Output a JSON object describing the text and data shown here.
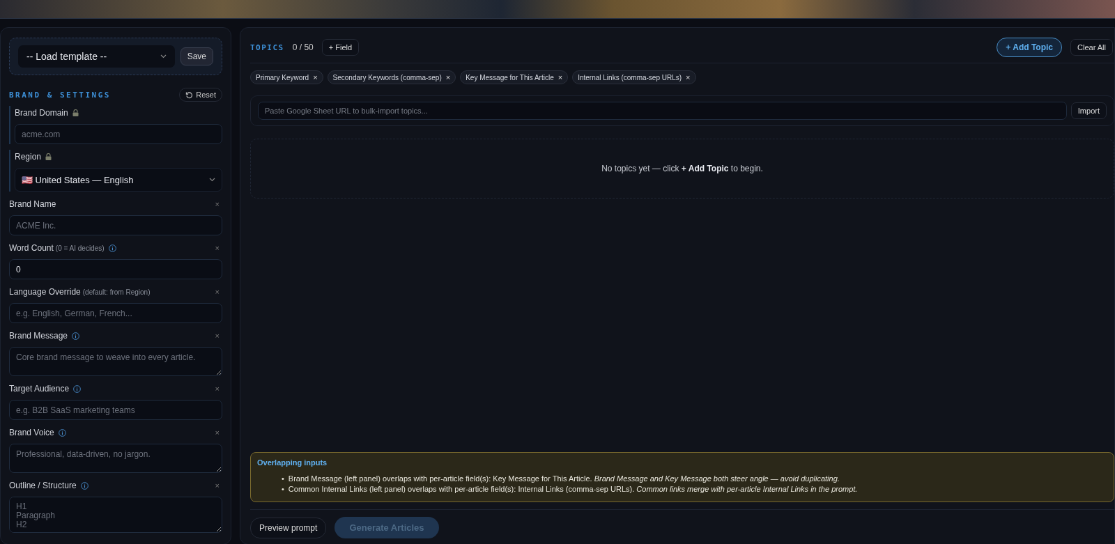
{
  "template": {
    "placeholder": "-- Load template --",
    "save": "Save"
  },
  "settings": {
    "title": "BRAND & SETTINGS",
    "reset": "Reset",
    "fields": [
      {
        "kind": "input",
        "label": "Brand Domain",
        "locked": true,
        "info": false,
        "placeholder": "acme.com"
      },
      {
        "kind": "select",
        "label": "Region",
        "locked": true,
        "info": false,
        "value": "🇺🇸 United States — English"
      },
      {
        "kind": "input",
        "label": "Brand Name",
        "locked": false,
        "info": false,
        "clear": "×",
        "placeholder": "ACME Inc."
      },
      {
        "kind": "input",
        "label": "Word Count",
        "hint": "(0 = AI decides)",
        "locked": false,
        "info": true,
        "clear": "×",
        "value": "0"
      },
      {
        "kind": "input",
        "label": "Language Override",
        "hint": "(default: from Region)",
        "locked": false,
        "info": false,
        "clear": "×",
        "placeholder": "e.g. English, German, French..."
      },
      {
        "kind": "textarea",
        "label": "Brand Message",
        "locked": false,
        "info": true,
        "clear": "×",
        "placeholder": "Core brand message to weave into every article."
      },
      {
        "kind": "input",
        "label": "Target Audience",
        "locked": false,
        "info": true,
        "clear": "×",
        "placeholder": "e.g. B2B SaaS marketing teams"
      },
      {
        "kind": "textarea",
        "label": "Brand Voice",
        "locked": false,
        "info": true,
        "clear": "×",
        "placeholder": "Professional, data-driven, no jargon."
      },
      {
        "kind": "textarea",
        "label": "Outline / Structure",
        "locked": false,
        "info": true,
        "clear": "×",
        "placeholder": "H1\nParagraph\nH2"
      }
    ]
  },
  "topics": {
    "title": "TOPICS",
    "count": "0 / 50",
    "add_field": "+ Field",
    "add_topic": "+ Add Topic",
    "clear_all": "Clear All",
    "fields": [
      {
        "label": "Primary Keyword",
        "remove": "×"
      },
      {
        "label": "Secondary Keywords (comma-sep)",
        "remove": "×"
      },
      {
        "label": "Key Message for This Article",
        "remove": "×"
      },
      {
        "label": "Internal Links (comma-sep URLs)",
        "remove": "×"
      }
    ],
    "import": {
      "placeholder": "Paste Google Sheet URL to bulk-import topics...",
      "button": "Import"
    },
    "empty": "No topics yet — click **+ Add Topic** to begin."
  },
  "warning": {
    "title": "Overlapping inputs",
    "bullet": "•",
    "items": [
      "Brand Message (left panel) overlaps with per-article field(s): Key Message for This Article. *Brand Message and Key Message both steer angle — avoid duplicating.*",
      "Common Internal Links (left panel) overlaps with per-article field(s): Internal Links (comma-sep URLs). *Common links merge with per-article Internal Links in the prompt.*"
    ]
  },
  "actions": {
    "preview": "Preview prompt",
    "generate": "Generate Articles",
    "generate_disabled": true
  }
}
